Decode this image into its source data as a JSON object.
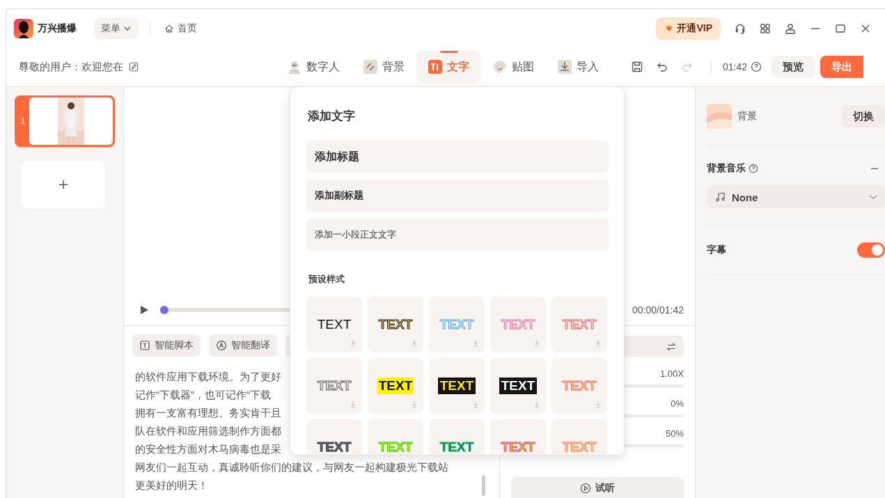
{
  "app": {
    "name": "万兴播爆",
    "menu": "菜单",
    "home": "首页",
    "vip": "开通VIP"
  },
  "toolbar": {
    "greeting": "尊敬的用户：欢迎您在",
    "tabs": [
      {
        "label": "数字人",
        "kind": "avatar",
        "selected": false
      },
      {
        "label": "背景",
        "kind": "background",
        "selected": false
      },
      {
        "label": "文字",
        "kind": "text",
        "selected": true
      },
      {
        "label": "贴图",
        "kind": "sticker",
        "selected": false
      },
      {
        "label": "导入",
        "kind": "import",
        "selected": false
      }
    ],
    "redo_disabled": true,
    "duration": "01:42",
    "preview": "预览",
    "export": "导出"
  },
  "slides": [
    {
      "number": "1",
      "selected": true
    }
  ],
  "player": {
    "level": 0,
    "time": "00:00/01:42"
  },
  "script": {
    "buttons": [
      "智能脚本",
      "智能翻译"
    ],
    "lines": [
      "的软件应用下载环境。为了更好",
      "记作“下载器”，也可记作“下载",
      "拥有一支富有理想、务实肯干且",
      "队在软件和应用筛选制作方面都",
      "的安全性方面对木马病毒也是采",
      "网友们一起互动，真诚聆听你们的建议，与网友一起构建极光下载站",
      "更美好的明天！"
    ]
  },
  "voice": {
    "values": [
      "1.00X",
      "0%",
      "50%"
    ],
    "listen": "试听"
  },
  "text_panel": {
    "title": "添加文字",
    "items": [
      {
        "label": "添加标题",
        "kind": "title"
      },
      {
        "label": "添加副标题",
        "kind": "subtitle"
      },
      {
        "label": "添加一小段正文文字",
        "kind": "body"
      }
    ],
    "presets_title": "预设样式",
    "presets": [
      {
        "text": "TEXT",
        "kind": "plain",
        "download_icon": true
      },
      {
        "text": "TEXT",
        "kind": "gold",
        "download_icon": true
      },
      {
        "text": "TEXT",
        "kind": "blue",
        "download_icon": true
      },
      {
        "text": "TEXT",
        "kind": "pink",
        "download_icon": true
      },
      {
        "text": "TEXT",
        "kind": "salmon",
        "download_icon": true
      },
      {
        "text": "TEXT",
        "kind": "gray",
        "download_icon": true
      },
      {
        "text": "TEXT",
        "kind": "yellowbox",
        "download_icon": true
      },
      {
        "text": "TEXT",
        "kind": "blackyellow",
        "download_icon": true
      },
      {
        "text": "TEXT",
        "kind": "blackwhite",
        "download_icon": true
      },
      {
        "text": "TEXT",
        "kind": "orangepink",
        "download_icon": true
      },
      {
        "text": "TEXT",
        "kind": "slate",
        "download_icon": false
      },
      {
        "text": "TEXT",
        "kind": "lime",
        "download_icon": false
      },
      {
        "text": "TEXT",
        "kind": "greenblue",
        "download_icon": false
      },
      {
        "text": "TEXT",
        "kind": "magyellow",
        "download_icon": false
      },
      {
        "text": "TEXT",
        "kind": "orangeoutline",
        "download_icon": false
      }
    ]
  },
  "right_panel": {
    "background_label": "背景",
    "switch": "切换",
    "music_title": "背景音乐",
    "music_value": "None",
    "subtitles_label": "字幕",
    "subtitles_on": true
  }
}
